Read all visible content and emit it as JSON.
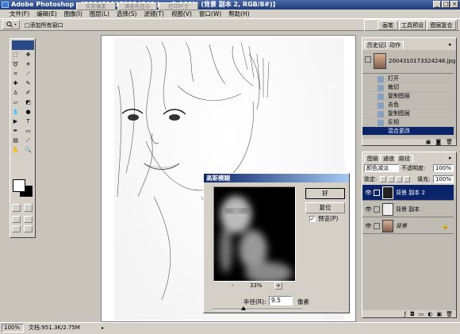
{
  "window": {
    "title": "Adobe Photoshop - [2004310173324248.jpg @ 100% (背景 副本 2, RGB/8#)]"
  },
  "menu": [
    "文件(F)",
    "编辑(E)",
    "图像(I)",
    "图层(L)",
    "选择(S)",
    "滤镜(T)",
    "视图(V)",
    "窗口(W)",
    "帮助(H)"
  ],
  "options_bar": {
    "resize_checkbox_label": "□添加所有窗口",
    "actual_pixels": "实际像素",
    "fit_screen": "满画布显示",
    "print_size": "打印尺寸",
    "wells": [
      "画笔",
      "工具预设",
      "图层复合"
    ]
  },
  "history_panel": {
    "tabs": [
      "历史记录",
      "动作"
    ],
    "snapshot": "2004310173324248.jpg",
    "items": [
      "打开",
      "裁切",
      "复制图层",
      "去色",
      "复制图层",
      "反相",
      "混合更改"
    ],
    "selected_index": 6
  },
  "layers_panel": {
    "tabs": [
      "图层",
      "通道",
      "路径"
    ],
    "blend_mode": "颜色减淡",
    "opacity_label": "不透明度:",
    "opacity_value": "100%",
    "lock_label": "锁定:",
    "fill_label": "填充:",
    "fill_value": "100%",
    "layers": [
      "背景 副本 2",
      "背景 副本",
      "背景"
    ],
    "selected_index": 0
  },
  "dialog": {
    "title": "高斯模糊",
    "ok": "好",
    "reset": "复位",
    "preview_label": "预览(P)",
    "preview_checked": true,
    "zoom": "33%",
    "radius_label": "半径(R):",
    "radius_value": "9.5",
    "radius_unit": "像素",
    "minus": "-",
    "plus": "+"
  },
  "status": {
    "zoom": "100%",
    "doc": "文档:951.3K/2.75M"
  },
  "colors": {
    "title_bar": "#203c78",
    "selection": "#0a246a",
    "chrome": "#d4d0c8"
  }
}
